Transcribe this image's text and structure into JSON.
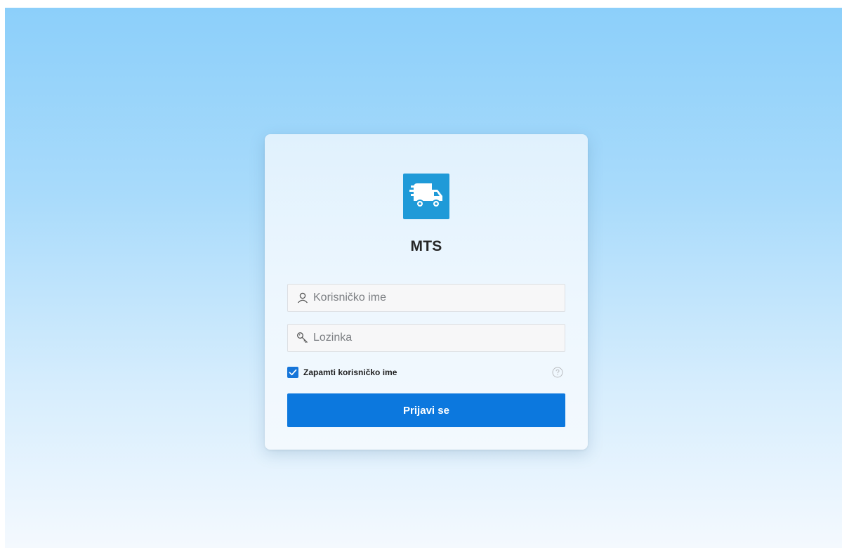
{
  "app": {
    "title": "MTS",
    "logo_icon": "delivery-truck-icon"
  },
  "form": {
    "username": {
      "icon": "user-icon",
      "placeholder": "Korisničko ime",
      "value": ""
    },
    "password": {
      "icon": "key-icon",
      "placeholder": "Lozinka",
      "value": ""
    },
    "remember": {
      "label": "Zapamti korisničko ime",
      "checked": true
    },
    "help_icon": "question-circle-icon",
    "submit_label": "Prijavi se"
  },
  "colors": {
    "accent": "#0c78de",
    "logo_bg": "#1f9ad8",
    "background_top": "#8ccffa",
    "background_bottom": "#f4f9fe"
  }
}
